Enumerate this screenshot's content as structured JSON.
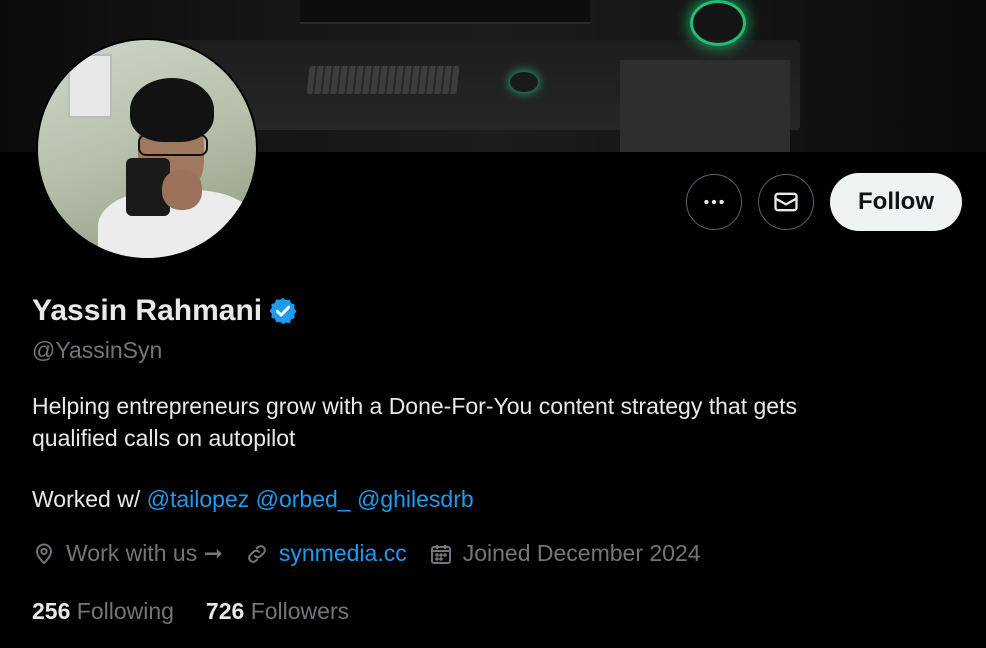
{
  "banner": {
    "icon": "header-photo"
  },
  "avatar": {
    "icon": "profile-photo"
  },
  "actions": {
    "more_icon": "ellipsis-icon",
    "message_icon": "mail-icon",
    "follow_label": "Follow"
  },
  "profile": {
    "name": "Yassin Rahmani",
    "verified_icon": "verified-badge-icon",
    "handle": "@YassinSyn",
    "bio_line1": "Helping entrepreneurs grow with a Done-For-You content strategy that gets",
    "bio_line2": "qualified calls on autopilot",
    "worked_with_prefix": "Worked w/",
    "mentions": [
      "@tailopez",
      "@orbed_",
      "@ghilesdrb"
    ]
  },
  "meta": {
    "location": "Work with us ➞",
    "website": "synmedia.cc",
    "joined": "Joined December 2024"
  },
  "stats": {
    "following_count": "256",
    "following_label": "Following",
    "followers_count": "726",
    "followers_label": "Followers"
  },
  "colors": {
    "background": "#000000",
    "accent": "#1d9bf0",
    "secondary_text": "#71767b",
    "primary_text": "#e7e9ea",
    "follow_button_bg": "#eff3f4"
  }
}
